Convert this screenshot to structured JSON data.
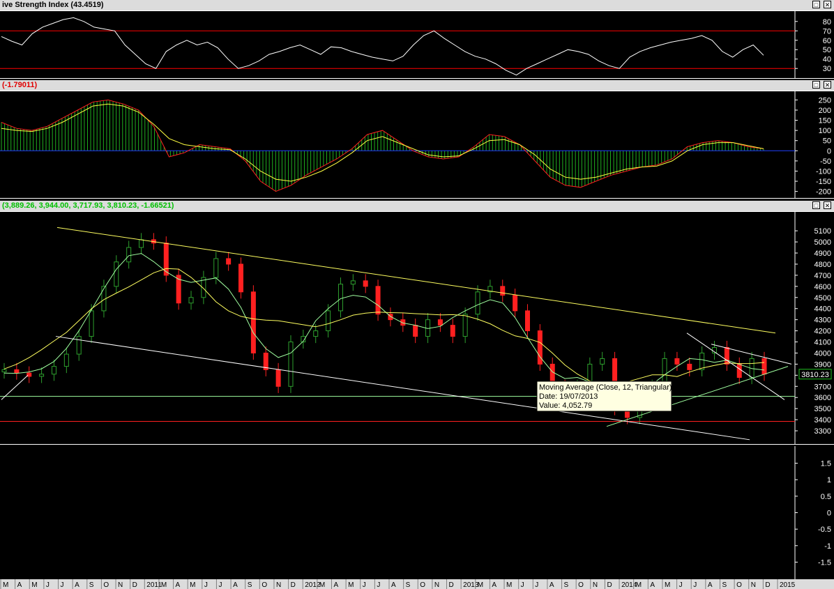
{
  "panes": {
    "rsi": {
      "title": "ive Strength Index (43.4519)",
      "title_color": "#000000"
    },
    "macd": {
      "title": "(-1.79011)",
      "title_color": "#e00000"
    },
    "price": {
      "title": "(3,889.26, 3,944.00, 3,717.93, 3,810.23, -1.66521)",
      "title_color": "#00c000"
    }
  },
  "tooltip": {
    "line1": "Moving Average (Close, 12, Triangular)",
    "line2": "Date: 19/07/2013",
    "line3": "Value: 4,052.79"
  },
  "last_price_label": "3810.23",
  "icons": [
    "restore-icon",
    "close-icon"
  ],
  "chart_data": [
    {
      "type": "line",
      "name": "RSI",
      "yaxis_ticks": [
        80,
        70,
        60,
        50,
        40,
        30
      ],
      "ylim": [
        22,
        88
      ],
      "levels": [
        70,
        30
      ],
      "series": [
        {
          "values": [
            64,
            59,
            55,
            67,
            74,
            78,
            82,
            84,
            80,
            74,
            72,
            70,
            55,
            45,
            35,
            30,
            48,
            55,
            60,
            55,
            58,
            52,
            40,
            30,
            33,
            38,
            45,
            48,
            52,
            55,
            50,
            45,
            53,
            52,
            48,
            45,
            42,
            40,
            38,
            43,
            55,
            65,
            70,
            62,
            55,
            48,
            43,
            40,
            35,
            28,
            23,
            30,
            35,
            40,
            45,
            50,
            48,
            45,
            38,
            33,
            30,
            42,
            48,
            52,
            55,
            58,
            60,
            62,
            65,
            60,
            48,
            42,
            50,
            55,
            44
          ]
        }
      ]
    },
    {
      "type": "line",
      "name": "MACD",
      "yaxis_ticks": [
        250,
        200,
        150,
        100,
        50,
        0,
        -50,
        -100,
        -150,
        -200
      ],
      "ylim": [
        -215,
        265
      ],
      "series": [
        {
          "name": "MACD",
          "color": "#ff2020",
          "values": [
            140,
            110,
            100,
            120,
            160,
            200,
            240,
            250,
            230,
            200,
            120,
            -30,
            -10,
            30,
            20,
            10,
            -50,
            -150,
            -200,
            -170,
            -120,
            -80,
            -40,
            10,
            80,
            100,
            50,
            0,
            -30,
            -40,
            -30,
            20,
            80,
            70,
            30,
            -50,
            -130,
            -170,
            -180,
            -150,
            -120,
            -100,
            -80,
            -70,
            -40,
            20,
            40,
            50,
            40,
            20,
            10
          ]
        },
        {
          "name": "Signal",
          "color": "#ffff40",
          "values": [
            110,
            100,
            95,
            110,
            140,
            180,
            220,
            230,
            220,
            190,
            130,
            60,
            30,
            20,
            10,
            5,
            -40,
            -100,
            -140,
            -150,
            -130,
            -100,
            -60,
            -10,
            50,
            70,
            40,
            10,
            -20,
            -30,
            -25,
            10,
            50,
            55,
            30,
            -20,
            -90,
            -130,
            -140,
            -130,
            -110,
            -90,
            -80,
            -75,
            -50,
            0,
            30,
            40,
            40,
            25,
            10
          ]
        }
      ]
    },
    {
      "type": "candlestick",
      "name": "Price",
      "yaxis_ticks": [
        5100,
        5000,
        4900,
        4800,
        4700,
        4600,
        4500,
        4400,
        4300,
        4200,
        4100,
        4000,
        3900,
        3800,
        3700,
        3600,
        3500,
        3400,
        3300
      ],
      "ylim": [
        3200,
        5220
      ],
      "horizontal_lines": [
        {
          "value": 3610,
          "color": "#a0ffa0"
        },
        {
          "value": 3385,
          "color": "#ff2020"
        }
      ],
      "close": [
        3850,
        3820,
        3790,
        3810,
        3880,
        3990,
        4150,
        4380,
        4600,
        4820,
        4950,
        5020,
        4990,
        4700,
        4450,
        4500,
        4680,
        4850,
        4800,
        4550,
        4000,
        3850,
        3700,
        4100,
        4150,
        4200,
        4380,
        4620,
        4650,
        4600,
        4350,
        4300,
        4250,
        4150,
        4300,
        4250,
        4150,
        4350,
        4550,
        4600,
        4520,
        4380,
        4200,
        3900,
        3700,
        3650,
        3700,
        3900,
        3950,
        3500,
        3420,
        3620,
        3700,
        3950,
        3900,
        3850,
        4000,
        4050,
        3900,
        3780,
        3950,
        3810
      ]
    },
    {
      "type": "line",
      "name": "Empty indicator pane",
      "yaxis_ticks": [
        1.5,
        1.0,
        0.5,
        0.0,
        -0.5,
        -1.0,
        -1.5
      ],
      "ylim": [
        -1.85,
        1.85
      ]
    },
    {
      "type": "axis",
      "name": "Time axis",
      "x_tick_labels": [
        "M",
        "A",
        "M",
        "J",
        "J",
        "A",
        "S",
        "O",
        "N",
        "D",
        "2011",
        "M",
        "A",
        "M",
        "J",
        "J",
        "A",
        "S",
        "O",
        "N",
        "D",
        "2012",
        "M",
        "A",
        "M",
        "J",
        "J",
        "A",
        "S",
        "O",
        "N",
        "D",
        "2013",
        "M",
        "A",
        "M",
        "J",
        "J",
        "A",
        "S",
        "O",
        "N",
        "D",
        "2014",
        "M",
        "A",
        "M",
        "J",
        "J",
        "A",
        "S",
        "O",
        "N",
        "D",
        "2015"
      ]
    }
  ]
}
